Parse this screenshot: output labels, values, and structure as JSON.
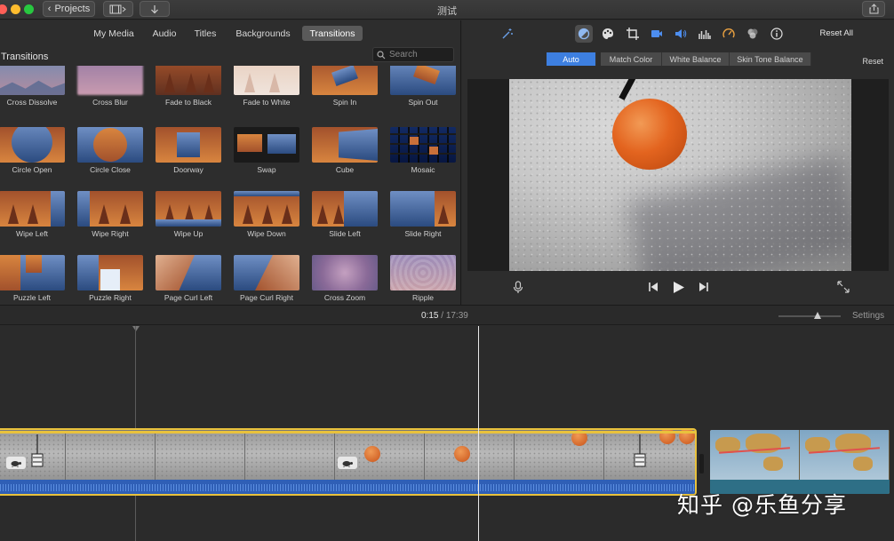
{
  "window": {
    "title": "测试",
    "projects_label": "Projects"
  },
  "browser": {
    "tabs": [
      "My Media",
      "Audio",
      "Titles",
      "Backgrounds",
      "Transitions"
    ],
    "active_tab": "Transitions",
    "panel_title": "Transitions",
    "search_placeholder": "Search",
    "transitions": [
      "Cross Dissolve",
      "Cross Blur",
      "Fade to Black",
      "Fade to White",
      "Spin In",
      "Spin Out",
      "Circle Open",
      "Circle Close",
      "Doorway",
      "Swap",
      "Cube",
      "Mosaic",
      "Wipe Left",
      "Wipe Right",
      "Wipe Up",
      "Wipe Down",
      "Slide Left",
      "Slide Right",
      "Puzzle Left",
      "Puzzle Right",
      "Page Curl Left",
      "Page Curl Right",
      "Cross Zoom",
      "Ripple"
    ]
  },
  "viewer": {
    "reset_all": "Reset All",
    "reset": "Reset",
    "color_modes": [
      "Auto",
      "Match Color",
      "White Balance",
      "Skin Tone Balance"
    ],
    "active_mode": "Auto",
    "toolbar_icons": [
      "magic-wand-icon",
      "color-balance-icon",
      "color-palette-icon",
      "crop-icon",
      "camera-icon",
      "volume-icon",
      "equalizer-icon",
      "speedometer-icon",
      "filter-icon",
      "info-icon"
    ]
  },
  "timeline": {
    "current_time": "0:15",
    "separator": " / ",
    "total_time": "17:39",
    "settings_label": "Settings"
  },
  "watermark": "知乎 @乐鱼分享",
  "colors": {
    "accent": "#3d7fe0",
    "selection": "#e9c23c",
    "audio": "#2f5fb6"
  }
}
